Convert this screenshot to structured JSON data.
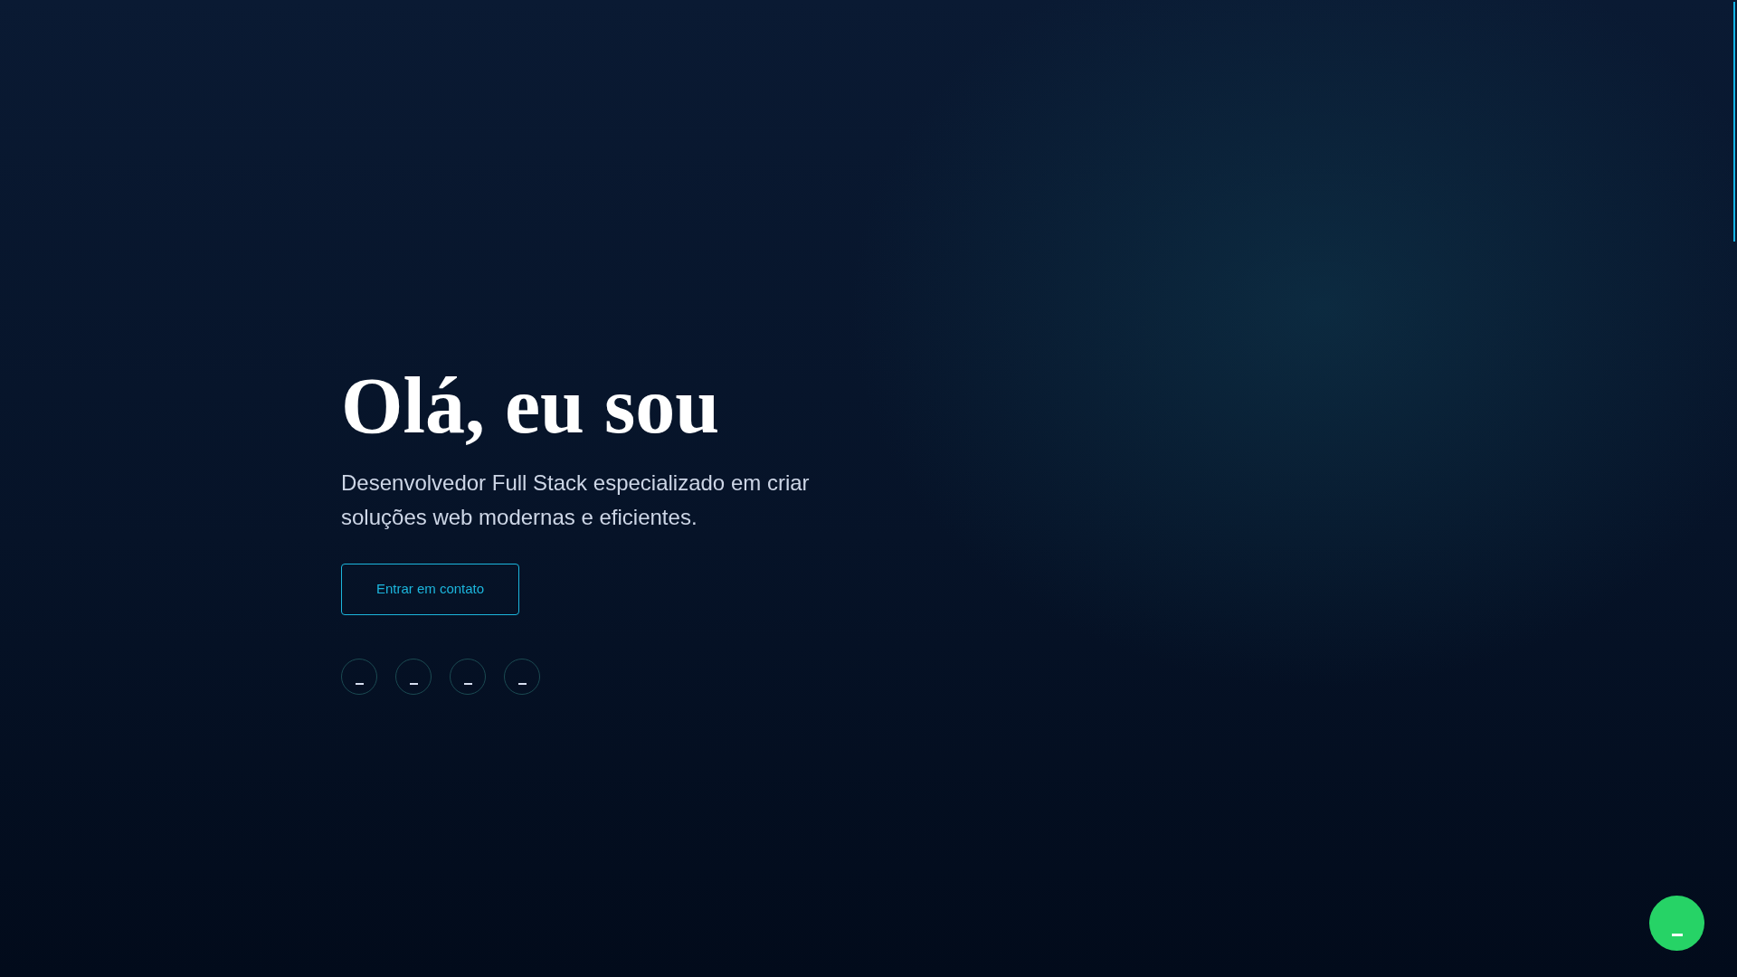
{
  "hero": {
    "heading": "Olá, eu sou",
    "subtitle": "Desenvolvedor Full Stack especializado em criar soluções web modernas e eficientes.",
    "button": "Entrar em contato"
  }
}
